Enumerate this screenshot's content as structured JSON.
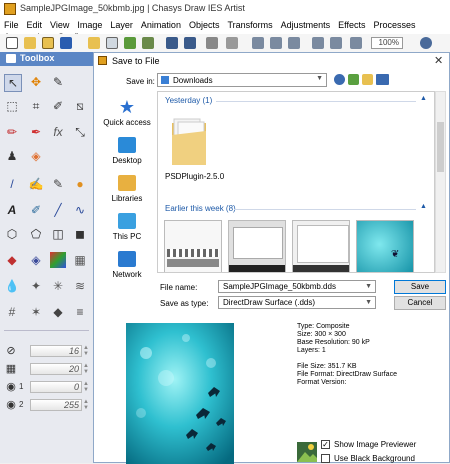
{
  "app": {
    "title": "SampleJPGImage_50kbmb.jpg | Chasys Draw IES Artist"
  },
  "menu": [
    "File",
    "Edit",
    "View",
    "Image",
    "Layer",
    "Animation",
    "Objects",
    "Transforms",
    "Adjustments",
    "Effects",
    "Processes",
    "Automation",
    "Configur"
  ],
  "toolbar": {
    "zoom": "100%"
  },
  "toolbox": {
    "title": "Toolbox",
    "sliders": [
      {
        "icon": "⊘",
        "label": "",
        "value": "16"
      },
      {
        "icon": "▦",
        "label": "",
        "value": "20"
      },
      {
        "icon": "◉",
        "label": "1",
        "value": "0"
      },
      {
        "icon": "◉",
        "label": "2",
        "value": "255"
      }
    ]
  },
  "dialog": {
    "title": "Save to File",
    "close": "✕",
    "save_in_label": "Save in:",
    "save_in_value": "Downloads",
    "places": [
      "Quick access",
      "Desktop",
      "Libraries",
      "This PC",
      "Network"
    ],
    "groups": {
      "yesterday": "Yesterday (1)",
      "earlier": "Earlier this week (8)"
    },
    "folder_name": "PSDPlugin-2.5.0",
    "file_name_label": "File name:",
    "file_name_value": "SampleJPGImage_50kbmb.dds",
    "save_as_label": "Save as type:",
    "save_as_value": "DirectDraw Surface (.dds)",
    "save_button": "Save",
    "cancel_button": "Cancel",
    "info": [
      "Type: Composite",
      "Size: 300 × 300",
      "Base Resolution: 90 kP",
      "Layers: 1",
      "",
      "File Size: 351.7 KB",
      "File Format: DirectDraw Surface",
      "Format Version:"
    ],
    "show_preview_label": "Show Image Previewer",
    "show_preview_checked": "✓",
    "black_bg_label": "Use Black Background"
  }
}
